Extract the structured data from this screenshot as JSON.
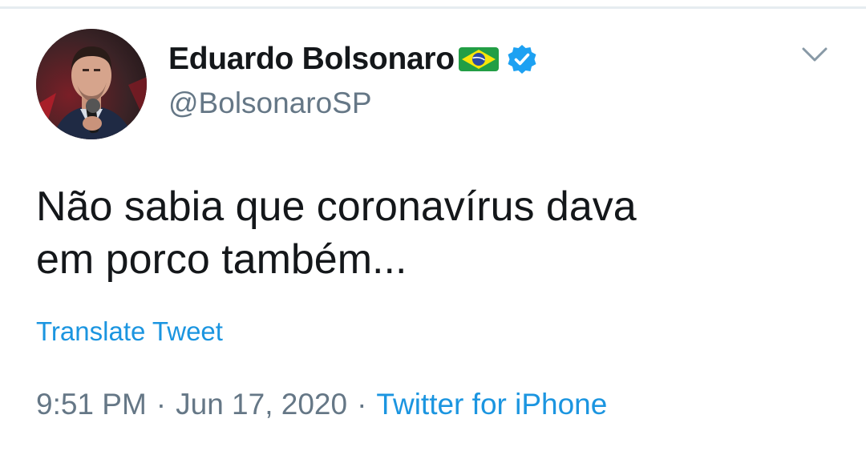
{
  "tweet": {
    "author": {
      "display_name": "Eduardo Bolsonaro",
      "handle": "@BolsonaroSP",
      "avatar_icon": "profile-photo",
      "flag_icon": "brazil-flag-emoji",
      "verified_icon": "verified-badge-icon"
    },
    "text": "Não sabia que coronavírus dava\nem porco também...",
    "translate_label": "Translate Tweet",
    "time": "9:51 PM",
    "separator": "·",
    "date": "Jun 17, 2020",
    "source": "Twitter for iPhone",
    "menu_icon": "chevron-down-icon"
  },
  "colors": {
    "text_primary": "#14171a",
    "text_secondary": "#657786",
    "link": "#1b95e0",
    "verified": "#1da1f2",
    "divider": "#e6ecf0"
  }
}
